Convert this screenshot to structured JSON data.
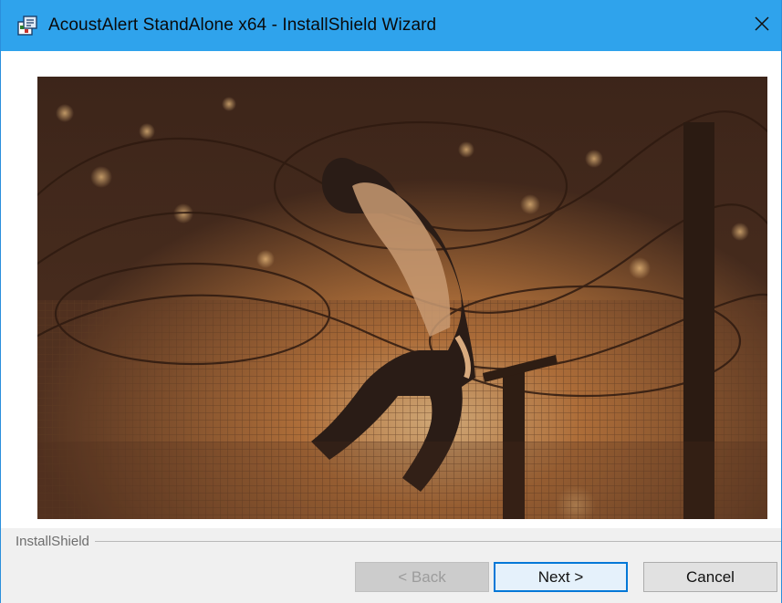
{
  "window": {
    "title": "AcoustAlert StandAlone x64 - InstallShield Wizard",
    "title_icon": "installer-icon",
    "close_glyph": "✕",
    "accent_color": "#2fa3ec"
  },
  "banner": {
    "image": "photo of a person climbing a razor-wire fence at night"
  },
  "brand": {
    "label": "InstallShield"
  },
  "buttons": {
    "back_label": "< Back",
    "back_enabled": false,
    "next_label": "Next >",
    "cancel_label": "Cancel"
  }
}
